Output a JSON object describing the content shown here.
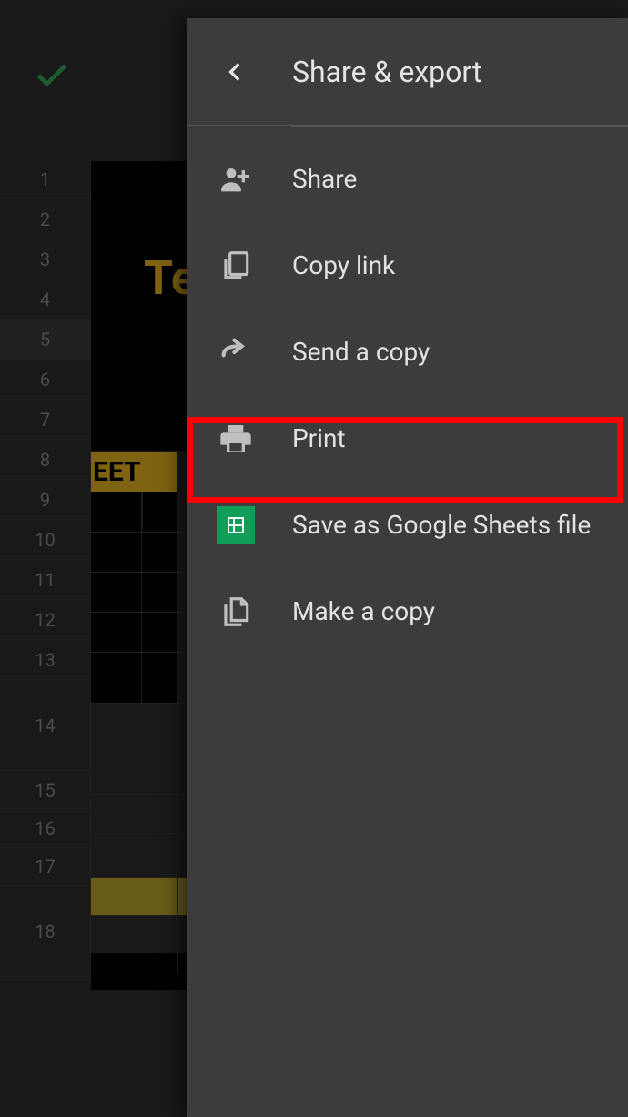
{
  "drawer": {
    "title": "Share & export",
    "items": [
      {
        "label": "Share",
        "icon": "person-add-icon"
      },
      {
        "label": "Copy link",
        "icon": "copy-link-icon"
      },
      {
        "label": "Send a copy",
        "icon": "send-arrow-icon"
      },
      {
        "label": "Print",
        "icon": "print-icon",
        "highlighted": true
      },
      {
        "label": "Save as Google Sheets file",
        "icon": "sheets-icon"
      },
      {
        "label": "Make a copy",
        "icon": "file-copy-icon"
      }
    ]
  },
  "background": {
    "toolbar": {
      "confirm_icon": "check-icon"
    },
    "visible_text": {
      "partial_title": "Te",
      "partial_header": "EET"
    },
    "row_numbers": [
      1,
      2,
      3,
      4,
      5,
      6,
      7,
      8,
      9,
      10,
      11,
      12,
      13,
      14,
      15,
      16,
      17,
      18
    ],
    "highlighted_row": 17
  },
  "colors": {
    "drawer_bg": "#3c3c3c",
    "text": "#e2e2e2",
    "accent_green": "#0f9d58",
    "highlight_red": "#ff0000",
    "sheet_yellow": "#e6b422"
  }
}
